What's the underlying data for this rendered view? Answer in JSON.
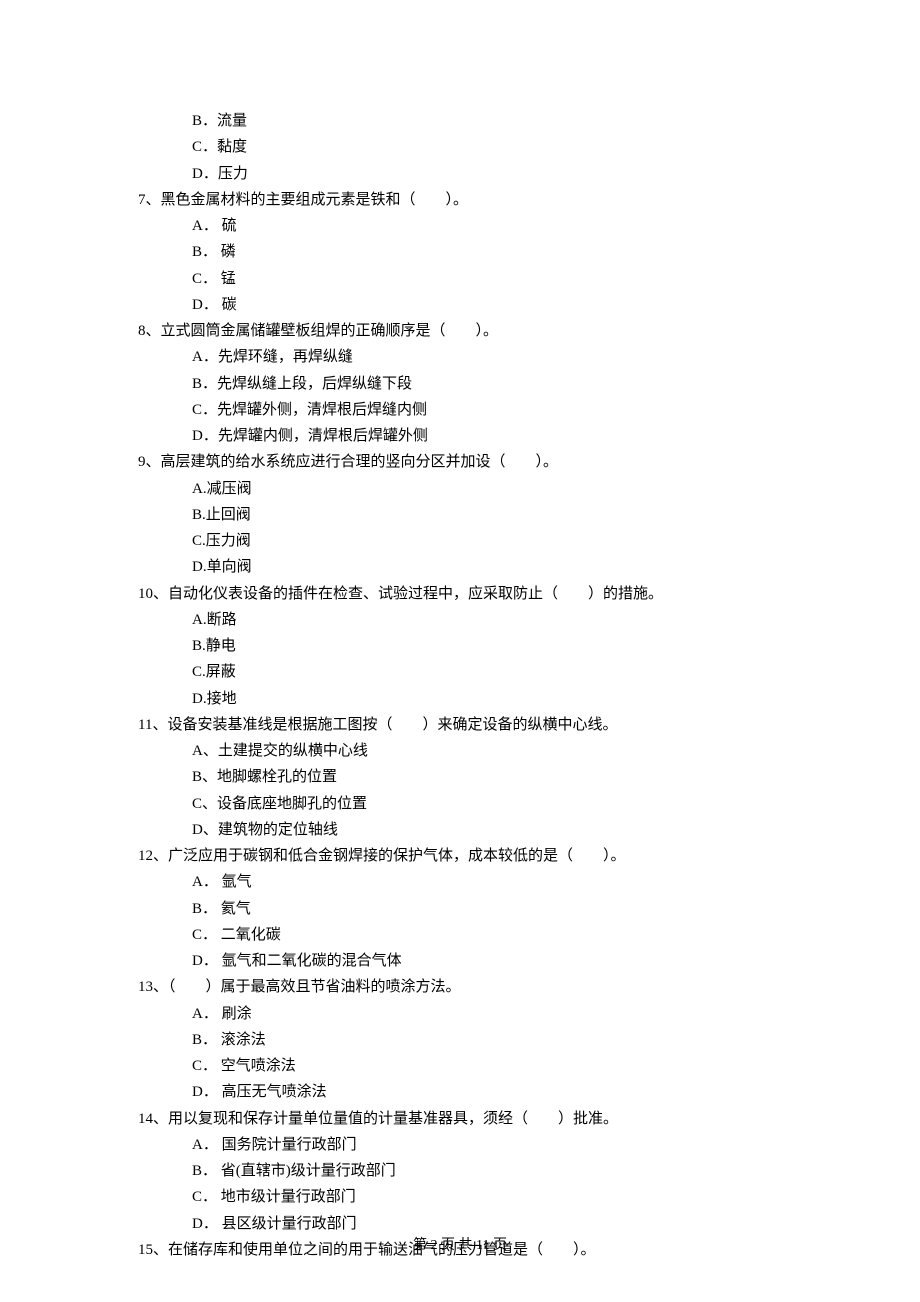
{
  "preOptions": [
    "B．流量",
    "C．黏度",
    "D．压力"
  ],
  "questions": [
    {
      "stem": "7、黑色金属材料的主要组成元素是铁和（　　）。",
      "options": [
        "A． 硫",
        "B． 磷",
        "C． 锰",
        "D． 碳"
      ]
    },
    {
      "stem": "8、立式圆筒金属储罐壁板组焊的正确顺序是（　　）。",
      "options": [
        "A．先焊环缝，再焊纵缝",
        "B．先焊纵缝上段，后焊纵缝下段",
        "C．先焊罐外侧，清焊根后焊缝内侧",
        "D．先焊罐内侧，清焊根后焊罐外侧"
      ]
    },
    {
      "stem": "9、高层建筑的给水系统应进行合理的竖向分区并加设（　　）。",
      "options": [
        "A.减压阀",
        "B.止回阀",
        "C.压力阀",
        "D.单向阀"
      ]
    },
    {
      "stem": "10、自动化仪表设备的插件在检查、试验过程中，应采取防止（　　）的措施。",
      "options": [
        "A.断路",
        "B.静电",
        "C.屏蔽",
        "D.接地"
      ]
    },
    {
      "stem": "11、设备安装基准线是根据施工图按（　　）来确定设备的纵横中心线。",
      "options": [
        "A、土建提交的纵横中心线",
        "B、地脚螺栓孔的位置",
        "C、设备底座地脚孔的位置",
        "D、建筑物的定位轴线"
      ]
    },
    {
      "stem": "12、广泛应用于碳钢和低合金钢焊接的保护气体，成本较低的是（　　）。",
      "options": [
        "A． 氩气",
        "B． 氦气",
        "C． 二氧化碳",
        "D． 氩气和二氧化碳的混合气体"
      ]
    },
    {
      "stem": "13、（　　）属于最高效且节省油料的喷涂方法。",
      "options": [
        "A． 刷涂",
        "B． 滚涂法",
        "C． 空气喷涂法",
        "D． 高压无气喷涂法"
      ]
    },
    {
      "stem": "14、用以复现和保存计量单位量值的计量基准器具，须经（　　）批准。",
      "options": [
        "A． 国务院计量行政部门",
        "B． 省(直辖市)级计量行政部门",
        "C． 地市级计量行政部门",
        "D． 县区级计量行政部门"
      ]
    },
    {
      "stem": "15、在储存库和使用单位之间的用于输送油气的压力管道是（　　）。",
      "options": []
    }
  ],
  "footer": "第 2 页 共 11 页"
}
